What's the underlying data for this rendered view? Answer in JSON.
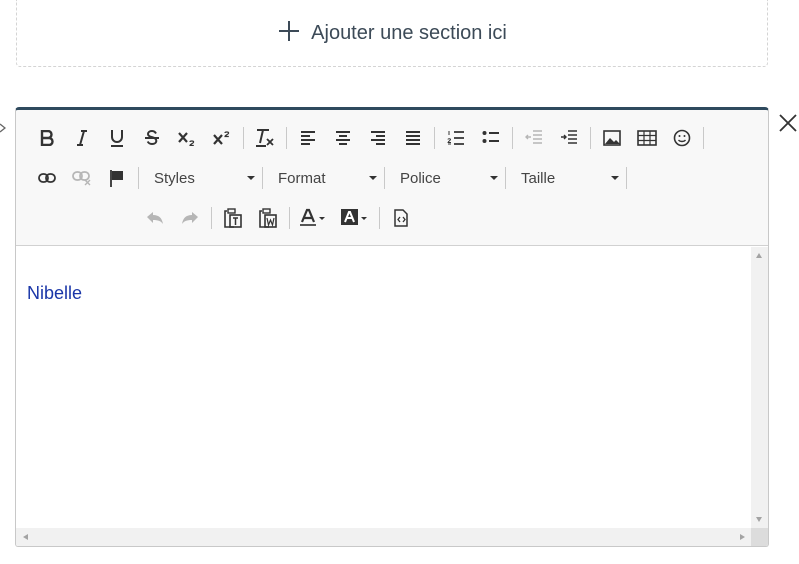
{
  "add_section": {
    "label": "Ajouter une section ici"
  },
  "toolbar": {
    "styles": "Styles",
    "format": "Format",
    "font": "Police",
    "size": "Taille"
  },
  "editor": {
    "content": "Nibelle"
  },
  "colors": {
    "accent_border": "#2f4a5e",
    "content_text": "#1a36a8"
  }
}
